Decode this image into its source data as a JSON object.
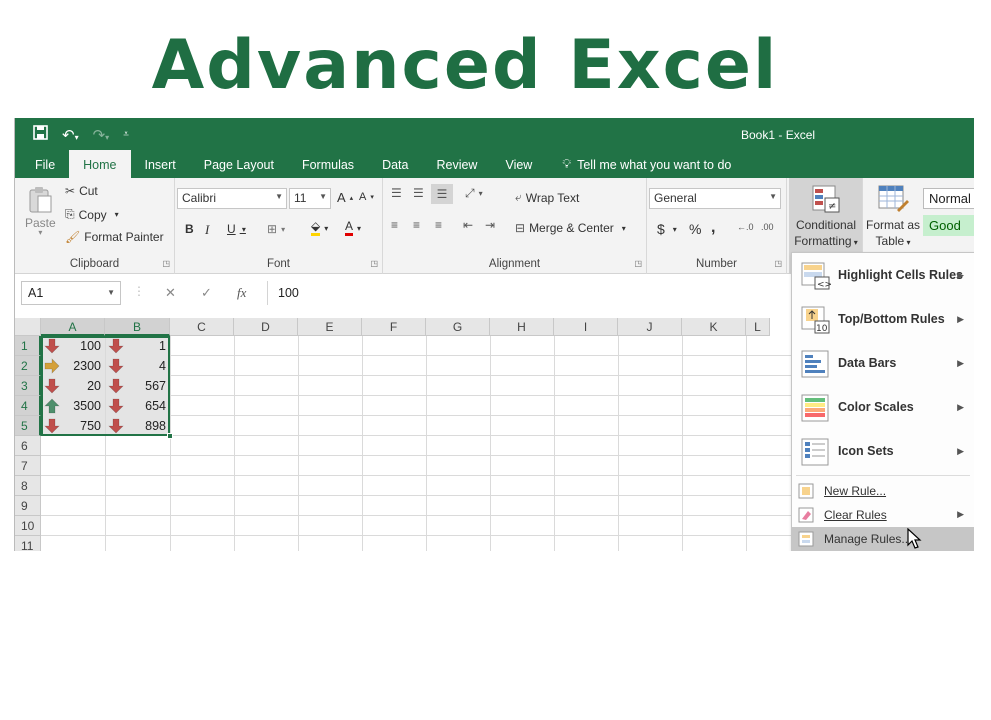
{
  "headline": "Advanced Excel",
  "window": {
    "title": "Book1 - Excel"
  },
  "tabs": [
    "File",
    "Home",
    "Insert",
    "Page Layout",
    "Formulas",
    "Data",
    "Review",
    "View"
  ],
  "tell_me": "Tell me what you want to do",
  "ribbon": {
    "clipboard": {
      "label": "Clipboard",
      "paste": "Paste",
      "cut": "Cut",
      "copy": "Copy",
      "format_painter": "Format Painter"
    },
    "font": {
      "label": "Font",
      "name": "Calibri",
      "size": "11",
      "bold": "B",
      "italic": "I",
      "underline": "U"
    },
    "alignment": {
      "label": "Alignment",
      "wrap": "Wrap Text",
      "merge": "Merge & Center"
    },
    "number": {
      "label": "Number",
      "format": "General",
      "currency": "$",
      "percent": "%",
      "comma": ","
    },
    "styles": {
      "conditional": "Conditional",
      "formatting": "Formatting",
      "format_as": "Format as",
      "table": "Table",
      "normal": "Normal",
      "good": "Good"
    }
  },
  "formula_bar": {
    "name_box": "A1",
    "fx": "fx",
    "value": "100"
  },
  "grid": {
    "columns": [
      "A",
      "B",
      "C",
      "D",
      "E",
      "F",
      "G",
      "H",
      "I",
      "J",
      "K",
      "L"
    ],
    "rows": [
      "1",
      "2",
      "3",
      "4",
      "5",
      "6",
      "7",
      "8",
      "9",
      "10",
      "11"
    ],
    "data": [
      {
        "a": "100",
        "a_icon": "down",
        "b": "1",
        "b_icon": "down"
      },
      {
        "a": "2300",
        "a_icon": "side",
        "b": "4",
        "b_icon": "down"
      },
      {
        "a": "20",
        "a_icon": "down",
        "b": "567",
        "b_icon": "down"
      },
      {
        "a": "3500",
        "a_icon": "up",
        "b": "654",
        "b_icon": "down"
      },
      {
        "a": "750",
        "a_icon": "down",
        "b": "898",
        "b_icon": "down"
      }
    ]
  },
  "menu": {
    "highlight": "Highlight Cells Rules",
    "topbottom": "Top/Bottom Rules",
    "databars": "Data Bars",
    "colorscales": "Color Scales",
    "iconsets": "Icon Sets",
    "newrule": "New Rule...",
    "clearrules": "Clear Rules",
    "managerules": "Manage Rules..."
  },
  "colors": {
    "excel_green": "#217346",
    "headline_green": "#1f6e43",
    "arrow_red": "#c0504d",
    "arrow_yellow": "#d4a03a",
    "arrow_green": "#4e8f6c"
  }
}
